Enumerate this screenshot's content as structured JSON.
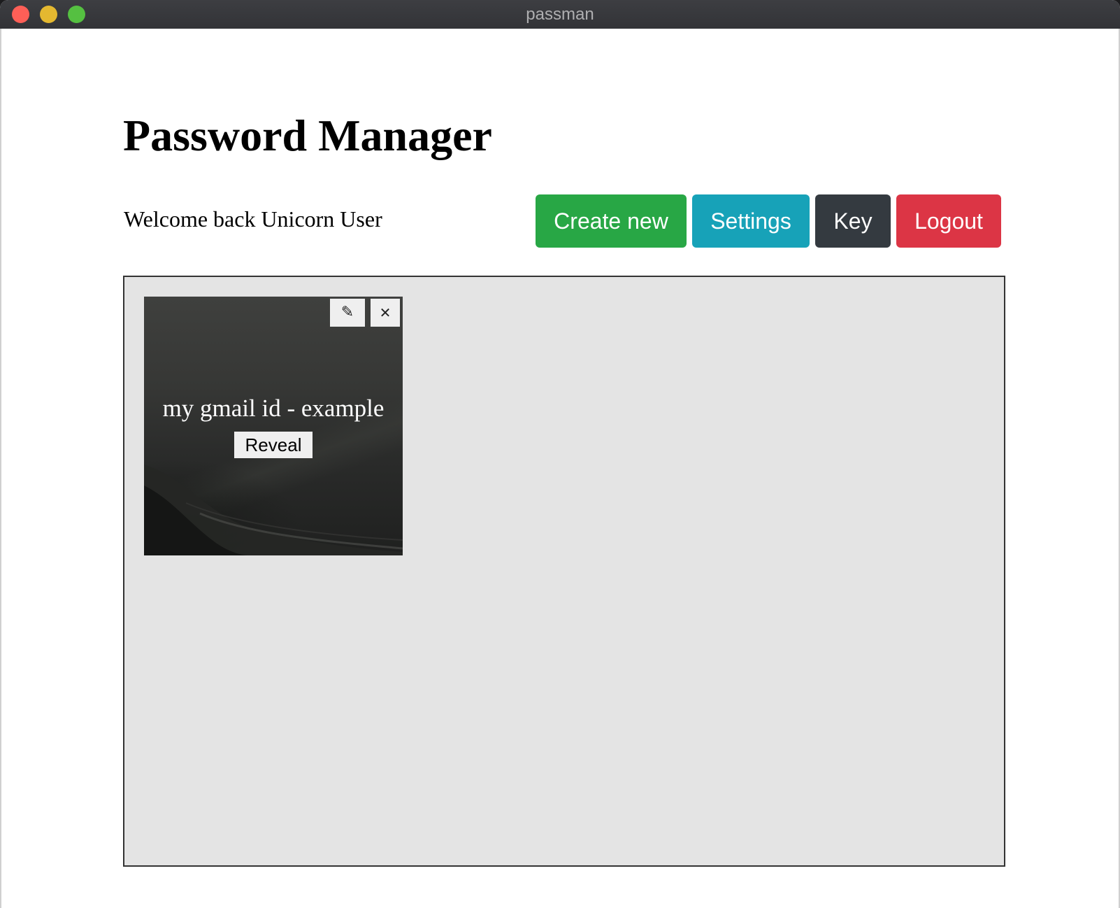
{
  "window": {
    "title": "passman"
  },
  "header": {
    "title": "Password Manager",
    "welcome": "Welcome back Unicorn User"
  },
  "toolbar": {
    "create_label": "Create new",
    "settings_label": "Settings",
    "key_label": "Key",
    "logout_label": "Logout"
  },
  "colors": {
    "create": "#28a745",
    "settings": "#17a2b8",
    "key": "#343a40",
    "logout": "#dc3545",
    "grid_background": "#e4e4e4"
  },
  "entries": [
    {
      "name": "my gmail id - example",
      "reveal_label": "Reveal",
      "edit_icon": "pencil-icon",
      "delete_icon": "close-icon",
      "edit_glyph": "✎",
      "delete_glyph": "✕"
    }
  ]
}
